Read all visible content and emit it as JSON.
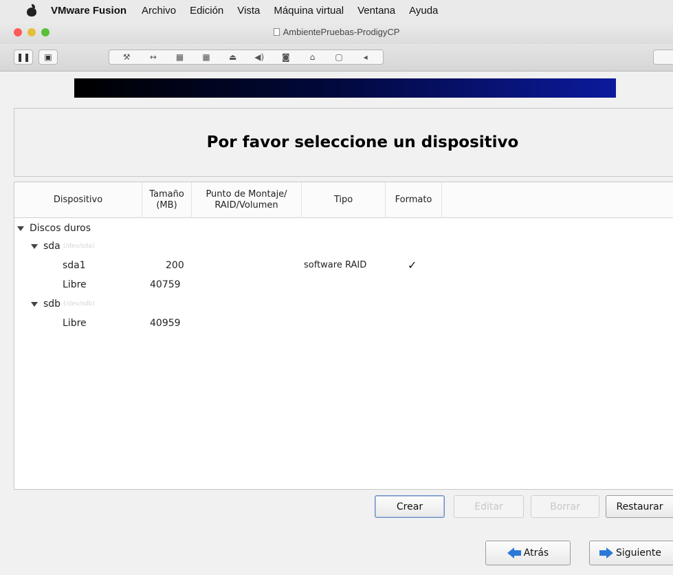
{
  "menubar": {
    "app_name": "VMware Fusion",
    "items": [
      "Archivo",
      "Edición",
      "Vista",
      "Máquina virtual",
      "Ventana",
      "Ayuda"
    ]
  },
  "window": {
    "title": "AmbientePruebas-ProdigyCP"
  },
  "toolbar": {
    "icons": [
      "pause-icon",
      "snapshot-icon",
      "settings-wrench-icon",
      "network-icon",
      "hard-disk-icon",
      "hard-disk-icon",
      "printer-icon",
      "sound-icon",
      "camera-icon",
      "usb-icon",
      "display-icon",
      "chevron-left-icon"
    ]
  },
  "installer": {
    "heading": "Por favor seleccione un dispositivo",
    "columns": {
      "device": "Dispositivo",
      "size_line1": "Tamaño",
      "size_line2": "(MB)",
      "mount_line1": "Punto de Montaje/",
      "mount_line2": "RAID/Volumen",
      "type": "Tipo",
      "format": "Formato"
    },
    "tree": {
      "root": "Discos duros",
      "disks": [
        {
          "name": "sda",
          "path": "(/dev/sda)",
          "partitions": [
            {
              "name": "sda1",
              "size": "200",
              "mount": "",
              "type": "software RAID",
              "format": "✓"
            },
            {
              "name": "Libre",
              "size": "40759",
              "mount": "",
              "type": "",
              "format": ""
            }
          ]
        },
        {
          "name": "sdb",
          "path": "(/dev/sdb)",
          "partitions": [
            {
              "name": "Libre",
              "size": "40959",
              "mount": "",
              "type": "",
              "format": ""
            }
          ]
        }
      ]
    },
    "buttons": {
      "create": "Crear",
      "edit": "Editar",
      "delete": "Borrar",
      "reset": "Restaurar",
      "back": "Atrás",
      "next": "Siguiente"
    }
  }
}
